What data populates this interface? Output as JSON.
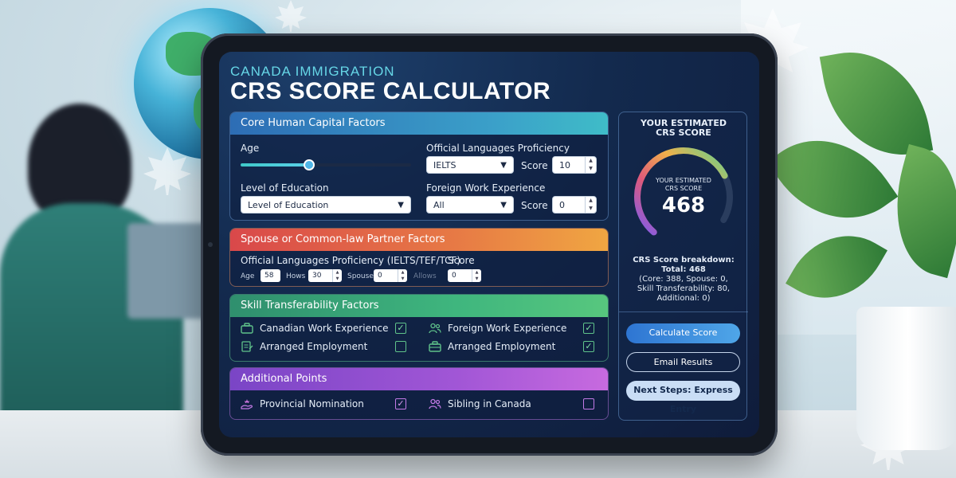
{
  "header": {
    "subtitle": "CANADA IMMIGRATION",
    "title": "CRS SCORE CALCULATOR"
  },
  "core": {
    "title": "Core Human Capital Factors",
    "age_label": "Age",
    "age_slider_fraction": 0.4,
    "education_label": "Level of Education",
    "education_value": "Level of Education",
    "language_label": "Official Languages Proficiency",
    "language_value": "IELTS",
    "language_score_label": "Score",
    "language_score_value": "10",
    "work_label": "Foreign Work Experience",
    "work_value": "All",
    "work_score_label": "Score",
    "work_score_value": "0"
  },
  "spouse": {
    "title": "Spouse or Common-law Partner Factors",
    "language_label": "Official Languages Proficiency (IELTS/TEF/TCF)",
    "score_label": "Score",
    "age_label": "Age",
    "age_value": "58",
    "hows_label": "Hows",
    "hows_value": "30",
    "spouse_label": "Spouse",
    "spouse_value": "0",
    "allows_label": "Allows",
    "allows_value": "0"
  },
  "skill": {
    "title": "Skill Transferability Factors",
    "items": [
      {
        "label": "Canadian Work Experience",
        "icon": "briefcase-icon",
        "checked": true
      },
      {
        "label": "Foreign Work Experience",
        "icon": "people-icon",
        "checked": true
      },
      {
        "label": "Arranged Employment",
        "icon": "document-icon",
        "checked": false
      },
      {
        "label": "Arranged Employment",
        "icon": "briefcase-icon",
        "checked": true
      }
    ]
  },
  "additional": {
    "title": "Additional Points",
    "items": [
      {
        "label": "Provincial Nomination",
        "icon": "hand-maple-icon",
        "checked": true
      },
      {
        "label": "Sibling in Canada",
        "icon": "people-icon",
        "checked": false
      }
    ]
  },
  "score_panel": {
    "title_line1": "YOUR ESTIMATED",
    "title_line2": "CRS SCORE",
    "gauge_label_line1": "YOUR ESTIMATED",
    "gauge_label_line2": "CRS SCORE",
    "score": "468",
    "gauge_fraction": 0.78,
    "breakdown_title": "CRS Score breakdown:",
    "breakdown_total": "Total: 468",
    "breakdown_line1": "(Core: 388, Spouse: 0,",
    "breakdown_line2": "Skill Transferability: 80,",
    "breakdown_line3": "Additional: 0)"
  },
  "buttons": {
    "calculate": "Calculate Score",
    "email": "Email Results",
    "next": "Next Steps: Express Entry"
  },
  "colors": {
    "core_accent": "#3ba0c9",
    "spouse_accent": "#e77a45",
    "skill_accent": "#3fb67e",
    "additional_accent": "#a156d6",
    "check_green": "#5fc28a",
    "check_purple": "#c27ae6"
  }
}
